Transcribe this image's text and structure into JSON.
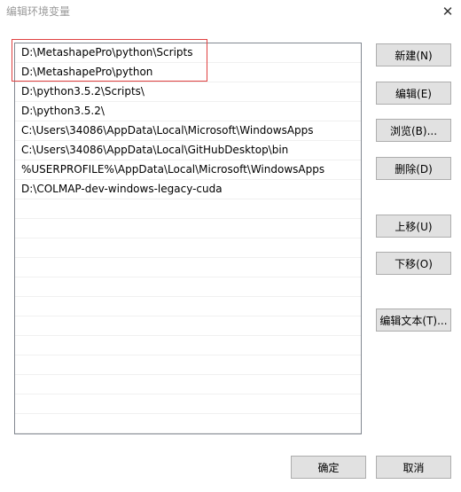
{
  "window": {
    "title": "编辑环境变量",
    "close_glyph": "✕"
  },
  "paths": [
    "D:\\MetashapePro\\python\\Scripts",
    "D:\\MetashapePro\\python",
    "D:\\python3.5.2\\Scripts\\",
    "D:\\python3.5.2\\",
    "C:\\Users\\34086\\AppData\\Local\\Microsoft\\WindowsApps",
    "C:\\Users\\34086\\AppData\\Local\\GitHubDesktop\\bin",
    "%USERPROFILE%\\AppData\\Local\\Microsoft\\WindowsApps",
    "D:\\COLMAP-dev-windows-legacy-cuda",
    "",
    "",
    "",
    "",
    "",
    "",
    "",
    "",
    "",
    "",
    "",
    "",
    ""
  ],
  "buttons": {
    "new": "新建(N)",
    "edit": "编辑(E)",
    "browse": "浏览(B)...",
    "delete": "删除(D)",
    "move_up": "上移(U)",
    "move_down": "下移(O)",
    "edit_text": "编辑文本(T)...",
    "ok": "确定",
    "cancel": "取消"
  },
  "colors": {
    "highlight_border": "#e04040",
    "title_text": "#9a9a9a",
    "button_face": "#e1e1e1"
  }
}
